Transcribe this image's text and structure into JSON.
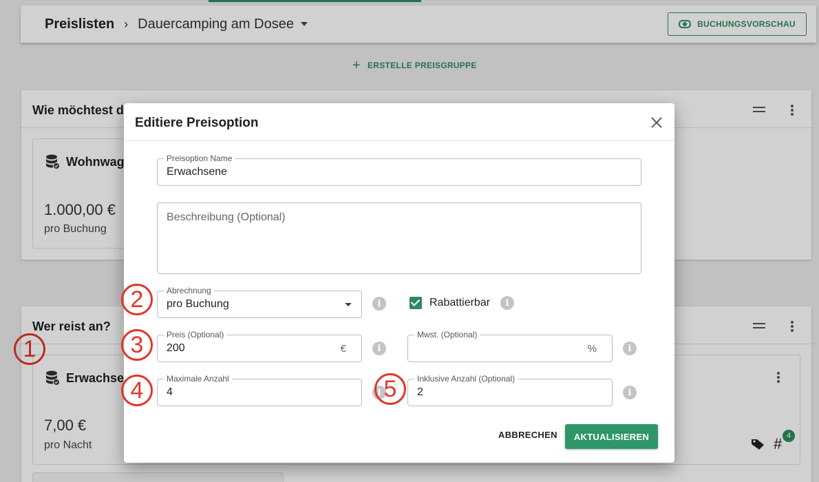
{
  "header": {
    "breadcrumb_root": "Preislisten",
    "breadcrumb_current": "Dauercamping am Dosee",
    "preview_button": "BUCHUNGSVORSCHAU"
  },
  "create_group_label": "ERSTELLE PREISGRUPPE",
  "groups": [
    {
      "title": "Wie möchtest d",
      "option": {
        "title": "Wohnwag",
        "price": "1.000,00 €",
        "unit": "pro Buchung"
      }
    },
    {
      "title": "Wer reist an?",
      "option": {
        "title": "Erwachse",
        "price": "7,00 €",
        "unit": "pro Nacht",
        "badge_count": "4",
        "hash_symbol": "#"
      }
    }
  ],
  "annotations": [
    "1",
    "2",
    "3",
    "4",
    "5"
  ],
  "dialog": {
    "title": "Editiere Preisoption",
    "name_field": {
      "label": "Preisoption Name",
      "value": "Erwachsene"
    },
    "description_field": {
      "placeholder": "Beschreibung (Optional)"
    },
    "billing_field": {
      "label": "Abrechnung",
      "value": "pro Buchung"
    },
    "discountable": {
      "label": "Rabattierbar",
      "checked": true
    },
    "price_field": {
      "label": "Preis (Optional)",
      "value": "200",
      "suffix": "€"
    },
    "vat_field": {
      "label": "Mwst. (Optional)",
      "value": "",
      "suffix": "%"
    },
    "max_count_field": {
      "label": "Maximale Anzahl",
      "value": "4"
    },
    "included_count_field": {
      "label": "Inklusive Anzahl (Optional)",
      "value": "2"
    },
    "cancel_button": "ABBRECHEN",
    "update_button": "AKTUALISIEREN"
  },
  "colors": {
    "accent": "#2f8a5e",
    "annotation": "#e2372b"
  }
}
